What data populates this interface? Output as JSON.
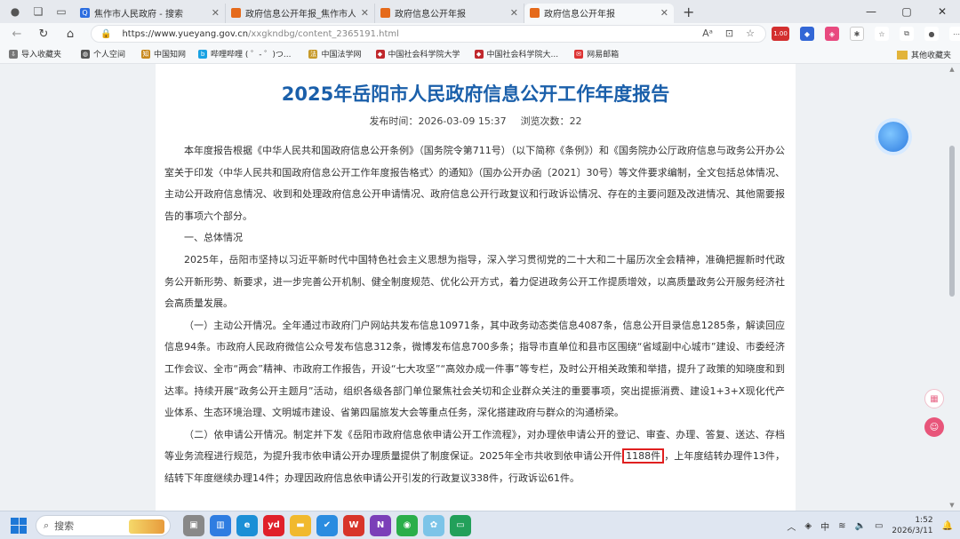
{
  "browser": {
    "tabs": [
      {
        "title": "焦作市人民政府 - 搜索",
        "favicon_color": "#2b6de0"
      },
      {
        "title": "政府信息公开年报_焦作市人民政府",
        "favicon_color": "#e56a1b"
      },
      {
        "title": "政府信息公开年报",
        "favicon_color": "#e56a1b"
      },
      {
        "title": "政府信息公开年报",
        "favicon_color": "#e56a1b",
        "active": true
      }
    ],
    "url_domain": "https://www.yueyang.gov.cn",
    "url_path": "/xxgkndbg/content_2365191.html",
    "badge": "1.00"
  },
  "bookmarks": {
    "items": [
      {
        "label": "导入收藏夹",
        "color": "#666"
      },
      {
        "label": "个人空间",
        "color": "#555"
      },
      {
        "label": "中国知网",
        "color": "#c88a1e"
      },
      {
        "label": "哔哩哔哩 ( ゜- ゜)つ...",
        "color": "#19a2e3"
      },
      {
        "label": "中国法学网",
        "color": "#c79a2a"
      },
      {
        "label": "中国社会科学院大学",
        "color": "#c0282d"
      },
      {
        "label": "中国社会科学院大...",
        "color": "#c0282d"
      },
      {
        "label": "网易邮箱",
        "color": "#d33"
      }
    ],
    "other": "其他收藏夹"
  },
  "article": {
    "title": "2025年岳阳市人民政府信息公开工作年度报告",
    "publish_label": "发布时间：",
    "publish_time": "2026-03-09 15:37",
    "views_label": "浏览次数：",
    "views": "22",
    "para1": "本年度报告根据《中华人民共和国政府信息公开条例》（国务院令第711号）（以下简称《条例》）和《国务院办公厅政府信息与政务公开办公室关于印发〈中华人民共和国政府信息公开工作年度报告格式〉的通知》（国办公开办函〔2021〕30号）等文件要求编制，全文包括总体情况、主动公开政府信息情况、收到和处理政府信息公开申请情况、政府信息公开行政复议和行政诉讼情况、存在的主要问题及改进情况、其他需要报告的事项六个部分。",
    "section1": "一、总体情况",
    "para2": "2025年，岳阳市坚持以习近平新时代中国特色社会主义思想为指导，深入学习贯彻党的二十大和二十届历次全会精神，准确把握新时代政务公开新形势、新要求，进一步完善公开机制、健全制度规范、优化公开方式，着力促进政务公开工作提质增效，以高质量政务公开服务经济社会高质量发展。",
    "para3": "（一）主动公开情况。全年通过市政府门户网站共发布信息10971条，其中政务动态类信息4087条，信息公开目录信息1285条，解读回应信息94条。市政府人民政府微信公众号发布信息312条，微博发布信息700多条；指导市直单位和县市区围绕“省域副中心城市”建设、市委经济工作会议、全市“两会”精神、市政府工作报告，开设“七大攻坚”“高效办成一件事”等专栏，及时公开相关政策和举措，提升了政策的知晓度和到达率。持续开展“政务公开主题月”活动，组织各级各部门单位聚焦社会关切和企业群众关注的重要事项，突出提振消费、建设1+3+X现化代产业体系、生态环境治理、文明城市建设、省第四届旅发大会等重点任务，深化搭建政府与群众的沟通桥梁。",
    "para4_a": "（二）依申请公开情况。制定并下发《岳阳市政府信息依申请公开工作流程》，对办理依申请公开的登记、审查、办理、答复、送达、存档等业务流程进行规范，为提升我市依申请公开办理质量提供了制度保证。2025年全市共收到依申请公开件",
    "para4_hl": "1188件",
    "para4_b": "，上年度结转办理件13件，结转下年度继续办理14件；办理因政府信息依申请公开引发的行政复议338件，行政诉讼61件。"
  },
  "taskbar": {
    "search_placeholder": "搜索",
    "ime": "中",
    "time": "1:52",
    "date": "2026/3/11"
  }
}
